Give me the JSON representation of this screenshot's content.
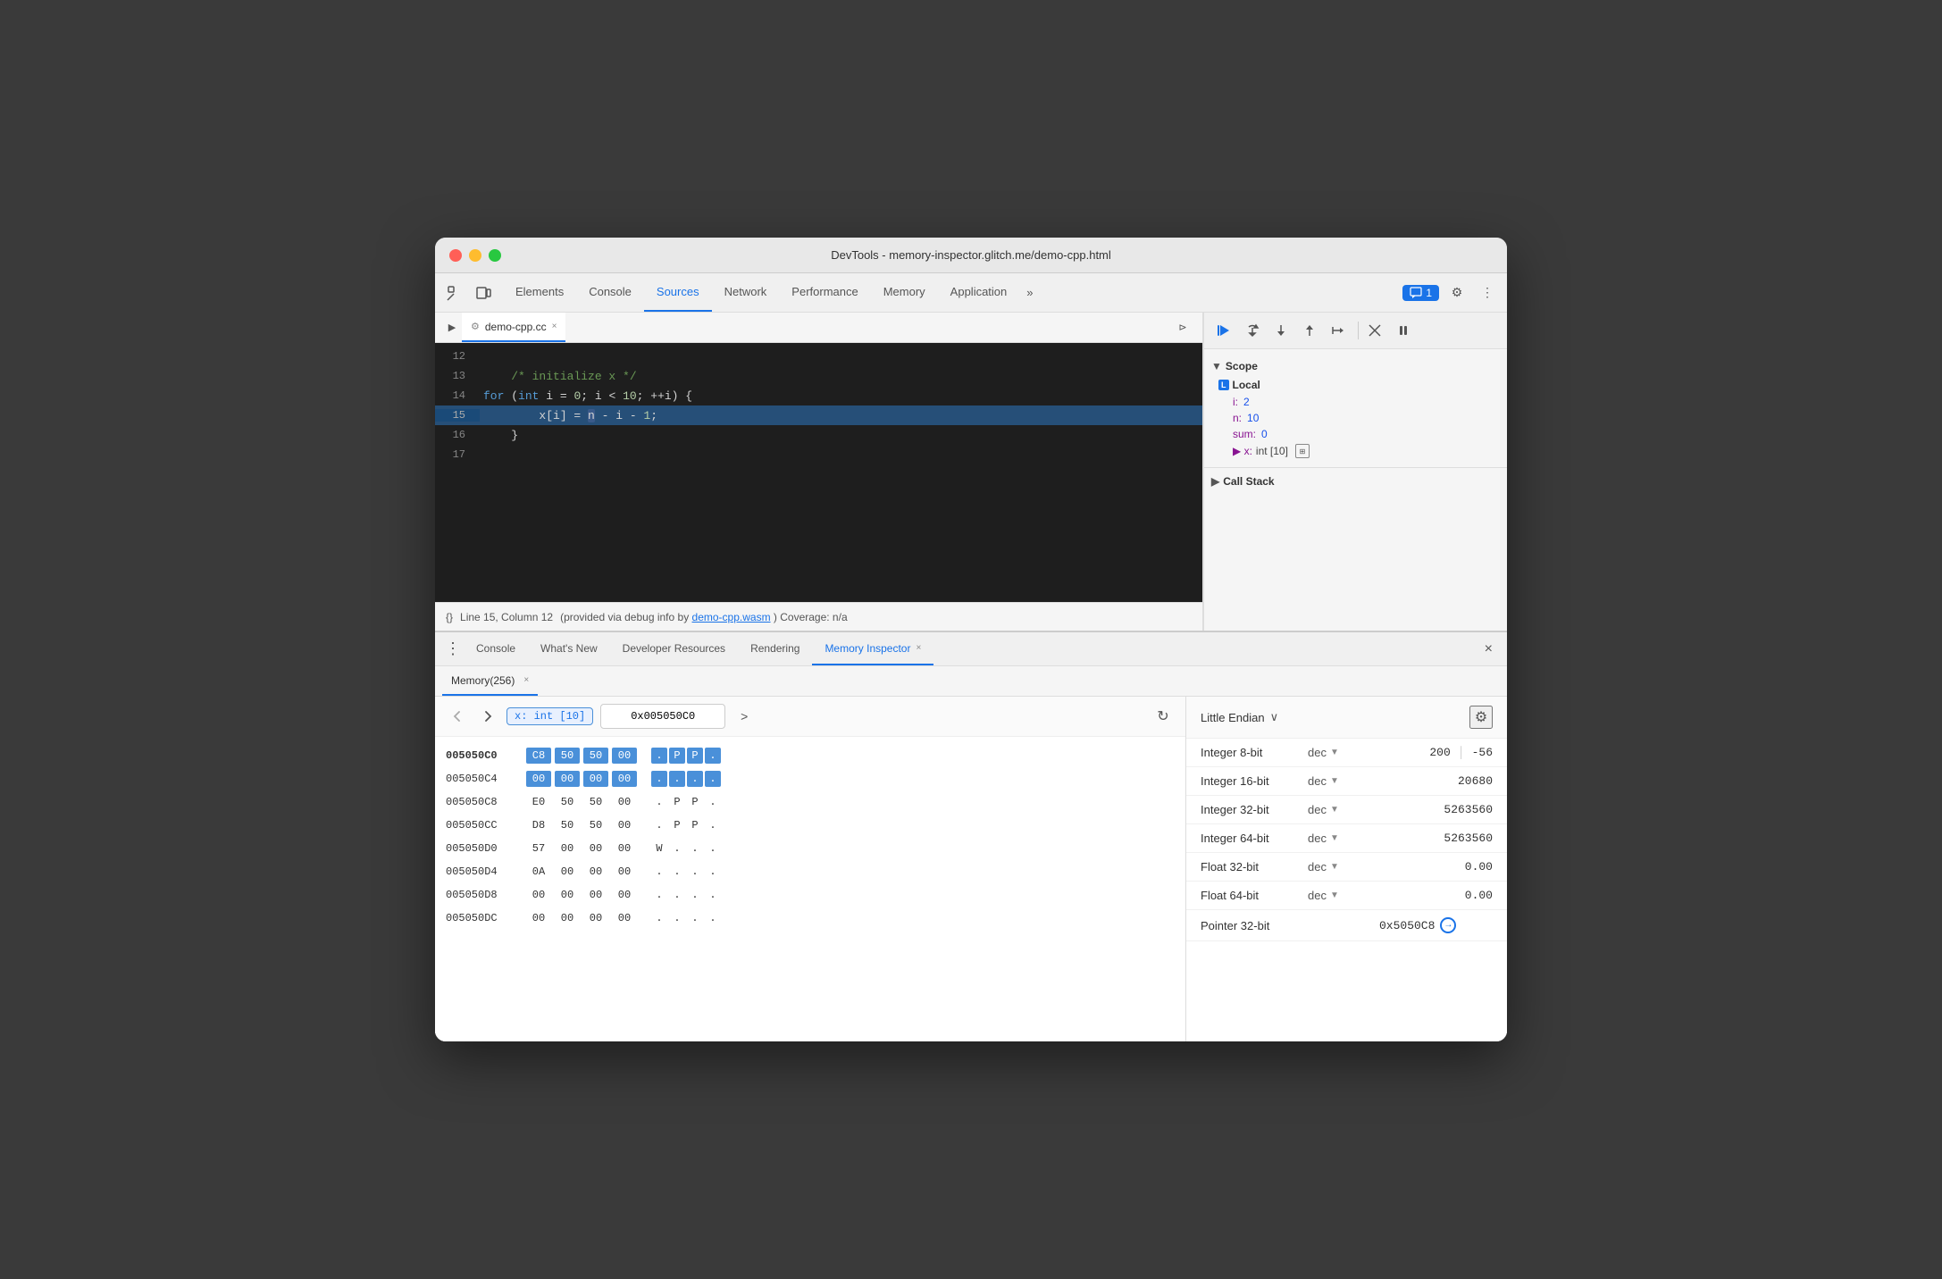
{
  "window": {
    "title": "DevTools - memory-inspector.glitch.me/demo-cpp.html",
    "traffic_lights": [
      "red",
      "yellow",
      "green"
    ]
  },
  "top_toolbar": {
    "inspect_icon": "⊡",
    "device_icon": "▭",
    "tabs": [
      {
        "id": "elements",
        "label": "Elements",
        "active": false
      },
      {
        "id": "console",
        "label": "Console",
        "active": false
      },
      {
        "id": "sources",
        "label": "Sources",
        "active": true
      },
      {
        "id": "network",
        "label": "Network",
        "active": false
      },
      {
        "id": "performance",
        "label": "Performance",
        "active": false
      },
      {
        "id": "memory",
        "label": "Memory",
        "active": false
      },
      {
        "id": "application",
        "label": "Application",
        "active": false
      }
    ],
    "more_tabs": "»",
    "badge_label": "1",
    "settings_icon": "⚙",
    "more_icon": "⋮"
  },
  "sources_panel": {
    "file_tab": {
      "icon": "▶",
      "name": "demo-cpp.cc",
      "close": "×"
    },
    "file_nav_icon": "⊳",
    "code_lines": [
      {
        "num": "12",
        "content": "",
        "highlighted": false
      },
      {
        "num": "13",
        "content": "    /* initialize x */",
        "highlighted": false,
        "type": "comment"
      },
      {
        "num": "14",
        "content": "    for (int i = 0; i < 10; ++i) {",
        "highlighted": false
      },
      {
        "num": "15",
        "content": "        x[i] = n - i - 1;",
        "highlighted": true
      },
      {
        "num": "16",
        "content": "    }",
        "highlighted": false
      },
      {
        "num": "17",
        "content": "",
        "highlighted": false
      }
    ],
    "status": {
      "braces": "{}",
      "position": "Line 15, Column 12",
      "debug_info": "(provided via debug info by",
      "wasm_link": "demo-cpp.wasm",
      "coverage": ") Coverage: n/a"
    }
  },
  "scope_panel": {
    "debug_buttons": [
      {
        "id": "resume",
        "icon": "▶",
        "active": true
      },
      {
        "id": "step-over",
        "icon": "↩",
        "active": false
      },
      {
        "id": "step-into",
        "icon": "↓",
        "active": false
      },
      {
        "id": "step-out",
        "icon": "↑",
        "active": false
      },
      {
        "id": "step",
        "icon": "⇢",
        "active": false
      },
      {
        "id": "deactivate",
        "icon": "✎",
        "active": false
      },
      {
        "id": "pause",
        "icon": "⏸",
        "active": false
      }
    ],
    "scope": {
      "header": "Scope",
      "local_section": "Local",
      "items": [
        {
          "key": "i:",
          "val": "2",
          "type": "num"
        },
        {
          "key": "n:",
          "val": "10",
          "type": "num"
        },
        {
          "key": "sum:",
          "val": "0",
          "type": "num"
        },
        {
          "key": "x:",
          "val": "int [10]",
          "type": "arr",
          "has_memory": true
        }
      ]
    },
    "call_stack": "Call Stack"
  },
  "bottom_panel": {
    "tabs": [
      {
        "id": "console",
        "label": "Console",
        "active": false
      },
      {
        "id": "whats-new",
        "label": "What's New",
        "active": false
      },
      {
        "id": "developer-resources",
        "label": "Developer Resources",
        "active": false
      },
      {
        "id": "rendering",
        "label": "Rendering",
        "active": false
      },
      {
        "id": "memory-inspector",
        "label": "Memory Inspector",
        "active": true
      }
    ],
    "close_icon": "×",
    "memory_tab": {
      "label": "Memory(256)",
      "close": "×"
    }
  },
  "hex_viewer": {
    "nav_back": "↩",
    "nav_forward": "↪",
    "address": "0x005050C0",
    "next_icon": ">",
    "refresh_icon": "↻",
    "memory_badge": "x: int [10]",
    "rows": [
      {
        "addr": "005050C0",
        "bold": true,
        "bytes": [
          {
            "val": "C8",
            "hl": true
          },
          {
            "val": "50",
            "hl": true
          },
          {
            "val": "50",
            "hl": true
          },
          {
            "val": "00",
            "hl": true
          }
        ],
        "chars": [
          {
            "val": ".",
            "hl": true
          },
          {
            "val": "P",
            "hl": true
          },
          {
            "val": "P",
            "hl": true
          },
          {
            "val": ".",
            "hl": true
          }
        ]
      },
      {
        "addr": "005050C4",
        "bold": false,
        "bytes": [
          {
            "val": "00",
            "hl": true
          },
          {
            "val": "00",
            "hl": true
          },
          {
            "val": "00",
            "hl": true
          },
          {
            "val": "00",
            "hl": true
          }
        ],
        "chars": [
          {
            "val": ".",
            "hl": true
          },
          {
            "val": ".",
            "hl": true
          },
          {
            "val": ".",
            "hl": true
          },
          {
            "val": ".",
            "hl": true
          }
        ]
      },
      {
        "addr": "005050C8",
        "bold": false,
        "bytes": [
          {
            "val": "E0",
            "hl": false
          },
          {
            "val": "50",
            "hl": false
          },
          {
            "val": "50",
            "hl": false
          },
          {
            "val": "00",
            "hl": false
          }
        ],
        "chars": [
          {
            "val": ".",
            "hl": false
          },
          {
            "val": "P",
            "hl": false
          },
          {
            "val": "P",
            "hl": false
          },
          {
            "val": ".",
            "hl": false
          }
        ]
      },
      {
        "addr": "005050CC",
        "bold": false,
        "bytes": [
          {
            "val": "D8",
            "hl": false
          },
          {
            "val": "50",
            "hl": false
          },
          {
            "val": "50",
            "hl": false
          },
          {
            "val": "00",
            "hl": false
          }
        ],
        "chars": [
          {
            "val": ".",
            "hl": false
          },
          {
            "val": "P",
            "hl": false
          },
          {
            "val": "P",
            "hl": false
          },
          {
            "val": ".",
            "hl": false
          }
        ]
      },
      {
        "addr": "005050D0",
        "bold": false,
        "bytes": [
          {
            "val": "57",
            "hl": false
          },
          {
            "val": "00",
            "hl": false
          },
          {
            "val": "00",
            "hl": false
          },
          {
            "val": "00",
            "hl": false
          }
        ],
        "chars": [
          {
            "val": "W",
            "hl": false
          },
          {
            "val": ".",
            "hl": false
          },
          {
            "val": ".",
            "hl": false
          },
          {
            "val": ".",
            "hl": false
          }
        ]
      },
      {
        "addr": "005050D4",
        "bold": false,
        "bytes": [
          {
            "val": "0A",
            "hl": false
          },
          {
            "val": "00",
            "hl": false
          },
          {
            "val": "00",
            "hl": false
          },
          {
            "val": "00",
            "hl": false
          }
        ],
        "chars": [
          {
            "val": ".",
            "hl": false
          },
          {
            "val": ".",
            "hl": false
          },
          {
            "val": ".",
            "hl": false
          },
          {
            "val": ".",
            "hl": false
          }
        ]
      },
      {
        "addr": "005050D8",
        "bold": false,
        "bytes": [
          {
            "val": "00",
            "hl": false
          },
          {
            "val": "00",
            "hl": false
          },
          {
            "val": "00",
            "hl": false
          },
          {
            "val": "00",
            "hl": false
          }
        ],
        "chars": [
          {
            "val": ".",
            "hl": false
          },
          {
            "val": ".",
            "hl": false
          },
          {
            "val": ".",
            "hl": false
          },
          {
            "val": ".",
            "hl": false
          }
        ]
      },
      {
        "addr": "005050DC",
        "bold": false,
        "bytes": [
          {
            "val": "00",
            "hl": false
          },
          {
            "val": "00",
            "hl": false
          },
          {
            "val": "00",
            "hl": false
          },
          {
            "val": "00",
            "hl": false
          }
        ],
        "chars": [
          {
            "val": ".",
            "hl": false
          },
          {
            "val": ".",
            "hl": false
          },
          {
            "val": ".",
            "hl": false
          },
          {
            "val": ".",
            "hl": false
          }
        ]
      }
    ]
  },
  "value_inspector": {
    "endian": "Little Endian",
    "settings_icon": "⚙",
    "rows": [
      {
        "type": "Integer 8-bit",
        "format": "dec",
        "value1": "200",
        "value2": "-56",
        "split": true
      },
      {
        "type": "Integer 16-bit",
        "format": "dec",
        "value": "20680",
        "split": false
      },
      {
        "type": "Integer 32-bit",
        "format": "dec",
        "value": "5263560",
        "split": false
      },
      {
        "type": "Integer 64-bit",
        "format": "dec",
        "value": "5263560",
        "split": false
      },
      {
        "type": "Float 32-bit",
        "format": "dec",
        "value": "0.00",
        "split": false
      },
      {
        "type": "Float 64-bit",
        "format": "dec",
        "value": "0.00",
        "split": false
      },
      {
        "type": "Pointer 32-bit",
        "format": "",
        "value": "0x5050C8",
        "split": false,
        "has_link": true
      }
    ]
  }
}
